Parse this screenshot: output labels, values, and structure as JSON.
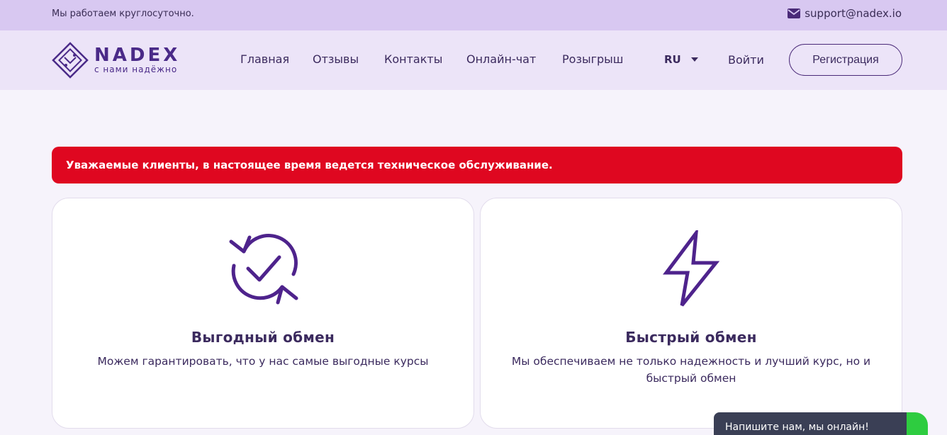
{
  "topbar": {
    "hours": "Мы работаем круглосуточно.",
    "email": "support@nadex.io"
  },
  "logo": {
    "brand": "NADEX",
    "tagline": "с нами надёжно"
  },
  "nav": {
    "items": [
      "Главная",
      "Отзывы",
      "Контакты",
      "Онлайн-чат",
      "Розыгрыш"
    ],
    "language": "RU",
    "login": "Войти",
    "register": "Регистрация"
  },
  "alert": {
    "text": "Уважаемые клиенты, в настоящее время ведется техническое обслуживание."
  },
  "cards": [
    {
      "icon": "refresh-check-icon",
      "title": "Выгодный обмен",
      "description": "Можем гарантировать, что у нас самые выгодные курсы"
    },
    {
      "icon": "lightning-icon",
      "title": "Быстрый обмен",
      "description": "Мы обеспечиваем не только надежность и лучший курс, но и быстрый обмен"
    }
  ],
  "chat": {
    "text": "Напишите нам, мы онлайн!"
  },
  "colors": {
    "accent": "#4a2a88",
    "alert": "#df0720",
    "topbar": "#d8c8f1",
    "header": "#ece4f8"
  }
}
